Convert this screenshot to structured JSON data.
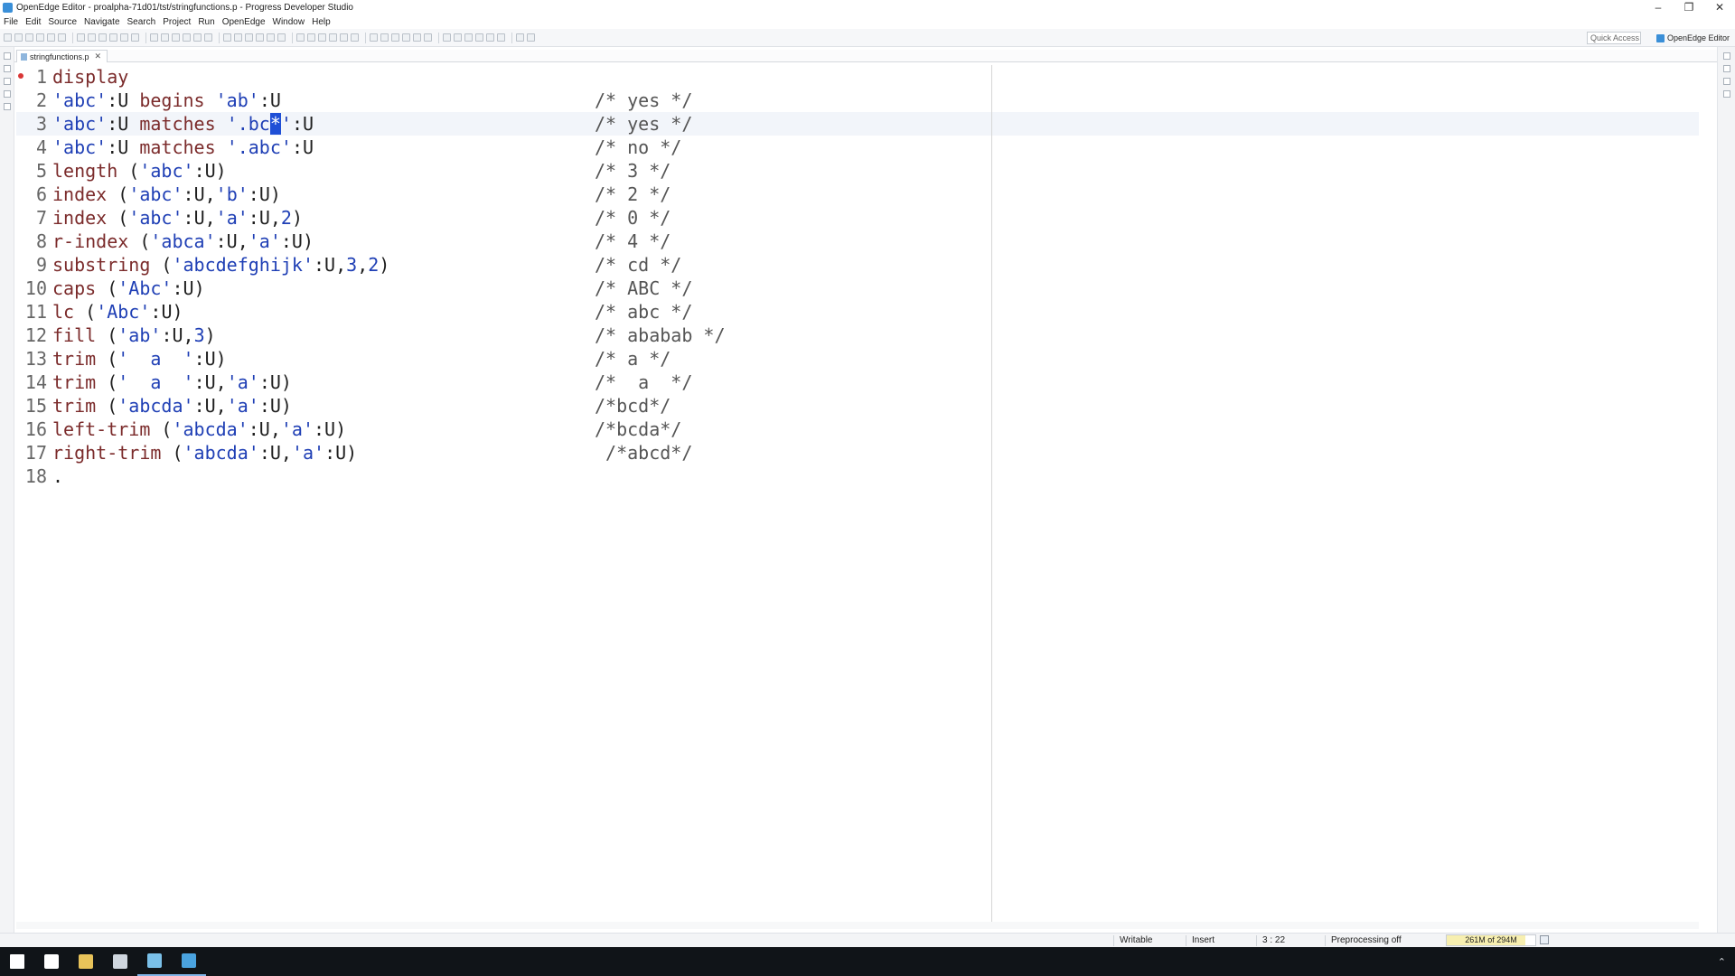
{
  "window": {
    "title": "OpenEdge Editor - proalpha-71d01/tst/stringfunctions.p - Progress Developer Studio",
    "controls": [
      "–",
      "❐",
      "✕"
    ]
  },
  "menu": [
    "File",
    "Edit",
    "Source",
    "Navigate",
    "Search",
    "Project",
    "Run",
    "OpenEdge",
    "Window",
    "Help"
  ],
  "toolbar": {
    "quick_access": "Quick Access",
    "perspective": "OpenEdge Editor"
  },
  "tab": {
    "label": "stringfunctions.p",
    "close": "✕"
  },
  "editor": {
    "lines": [
      {
        "n": "1",
        "html": "<span class='kw'>display</span>",
        "comment": ""
      },
      {
        "n": "2",
        "html": "<span class='str'>'abc'</span>:U <span class='kw'>begins</span> <span class='str'>'ab'</span>:U",
        "comment": "/* yes */"
      },
      {
        "n": "3",
        "html": "<span class='str'>'abc'</span>:U <span class='kw'>matches</span> <span class='str'>'.bc<span class='cursor-sel'>*</span>'</span>:U",
        "comment": "/* yes */"
      },
      {
        "n": "4",
        "html": "<span class='str'>'abc'</span>:U <span class='kw'>matches</span> <span class='str'>'.abc'</span>:U",
        "comment": "/* no */"
      },
      {
        "n": "5",
        "html": "<span class='kw'>length</span> (<span class='str'>'abc'</span>:U)",
        "comment": "/* 3 */"
      },
      {
        "n": "6",
        "html": "<span class='kw'>index</span> (<span class='str'>'abc'</span>:U,<span class='str'>'b'</span>:U)",
        "comment": "/* 2 */"
      },
      {
        "n": "7",
        "html": "<span class='kw'>index</span> (<span class='str'>'abc'</span>:U,<span class='str'>'a'</span>:U,<span class='num'>2</span>)",
        "comment": "/* 0 */"
      },
      {
        "n": "8",
        "html": "<span class='kw'>r-index</span> (<span class='str'>'abca'</span>:U,<span class='str'>'a'</span>:U)",
        "comment": "/* 4 */"
      },
      {
        "n": "9",
        "html": "<span class='kw'>substring</span> (<span class='str'>'abcdefghijk'</span>:U,<span class='num'>3</span>,<span class='num'>2</span>)",
        "comment": "/* cd */"
      },
      {
        "n": "10",
        "html": "<span class='kw'>caps</span> (<span class='str'>'Abc'</span>:U)",
        "comment": "/* ABC */"
      },
      {
        "n": "11",
        "html": "<span class='kw'>lc</span> (<span class='str'>'Abc'</span>:U)",
        "comment": "/* abc */"
      },
      {
        "n": "12",
        "html": "<span class='kw'>fill</span> (<span class='str'>'ab'</span>:U,<span class='num'>3</span>)",
        "comment": "/* ababab */"
      },
      {
        "n": "13",
        "html": "<span class='kw'>trim</span> (<span class='str'>'  a  '</span>:U)",
        "comment": "/* a */"
      },
      {
        "n": "14",
        "html": "<span class='kw'>trim</span> (<span class='str'>'  a  '</span>:U,<span class='str'>'a'</span>:U)",
        "comment": "/*  a  */"
      },
      {
        "n": "15",
        "html": "<span class='kw'>trim</span> (<span class='str'>'abcda'</span>:U,<span class='str'>'a'</span>:U)",
        "comment": "/*bcd*/"
      },
      {
        "n": "16",
        "html": "<span class='kw'>left-trim</span> (<span class='str'>'abcda'</span>:U,<span class='str'>'a'</span>:U)",
        "comment": "/*bcda*/"
      },
      {
        "n": "17",
        "html": "<span class='kw'>right-trim</span> (<span class='str'>'abcda'</span>:U,<span class='str'>'a'</span>:U)",
        "comment": " /*abcd*/"
      },
      {
        "n": "18",
        "html": ".",
        "comment": ""
      }
    ]
  },
  "status": {
    "writable": "Writable",
    "insert": "Insert",
    "position": "3 : 22",
    "preprocessing": "Preprocessing off",
    "heap": "261M of 294M",
    "heap_fraction": 0.89
  },
  "taskbar": {
    "items": [
      "windows-start-icon",
      "task-view-icon",
      "file-explorer-icon",
      "terminal-icon",
      "developer-studio-icon",
      "openedge-editor-icon"
    ]
  },
  "colors": {
    "keyword": "#7b2b2b",
    "string": "#1f3fb5",
    "selection": "#1f4fd6"
  }
}
